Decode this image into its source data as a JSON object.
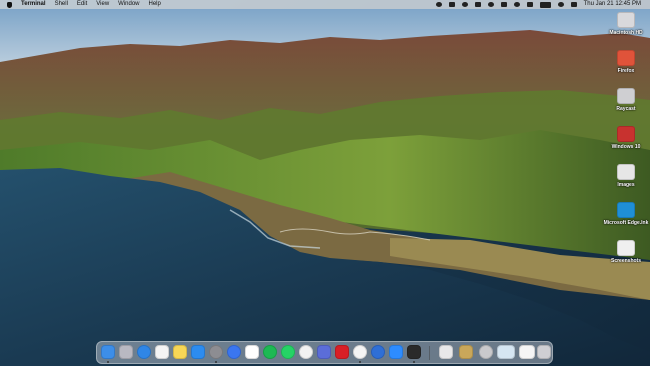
{
  "menubar": {
    "app_name": "Terminal",
    "menus": [
      "Shell",
      "Edit",
      "View",
      "Window",
      "Help"
    ],
    "clock": "Thu Jan 21  12:45 PM"
  },
  "desktop_icons": [
    {
      "label": "Macintosh HD",
      "icon": "hard-drive-icon",
      "color": "#d9d9dc"
    },
    {
      "label": "Firefox",
      "icon": "firefox-icon",
      "color": "#e0533a"
    },
    {
      "label": "Raycast",
      "icon": "raycast-icon",
      "color": "#cfcfd2"
    },
    {
      "label": "Windows 10",
      "icon": "windows-vm-icon",
      "color": "#c8322f"
    },
    {
      "label": "Images",
      "icon": "image-file-icon",
      "color": "#e6e6e6"
    },
    {
      "label": "Microsoft Edge.lnk",
      "icon": "edge-icon",
      "color": "#1f8fd6"
    },
    {
      "label": "Screenshots",
      "icon": "screenshot-file-icon",
      "color": "#efefef"
    }
  ],
  "dock": {
    "apps": [
      {
        "name": "Finder",
        "icon": "finder-icon",
        "color": "#3d8ee8",
        "running": true
      },
      {
        "name": "Launchpad",
        "icon": "launchpad-icon",
        "color": "#b9b9c2",
        "running": false
      },
      {
        "name": "Safari",
        "icon": "safari-icon",
        "color": "#2f86e6",
        "running": false
      },
      {
        "name": "Photos",
        "icon": "photos-icon",
        "color": "#f4f4f4",
        "running": false
      },
      {
        "name": "Notes",
        "icon": "notes-icon",
        "color": "#f6d656",
        "running": false
      },
      {
        "name": "App Store",
        "icon": "app-store-icon",
        "color": "#2c8cf0",
        "running": false
      },
      {
        "name": "System Preferences",
        "icon": "gear-icon",
        "color": "#8d8d92",
        "running": true
      },
      {
        "name": "Signal",
        "icon": "signal-icon",
        "color": "#3a76f0",
        "running": false
      },
      {
        "name": "Slack",
        "icon": "slack-icon",
        "color": "#ffffff",
        "running": false
      },
      {
        "name": "Spotify",
        "icon": "spotify-icon",
        "color": "#1db954",
        "running": false
      },
      {
        "name": "WhatsApp",
        "icon": "whatsapp-icon",
        "color": "#25d366",
        "running": false
      },
      {
        "name": "Todoist",
        "icon": "checkmark-icon",
        "color": "#f2f2f2",
        "running": false
      },
      {
        "name": "Screen Sharing",
        "icon": "screen-share-icon",
        "color": "#5b6dd8",
        "running": false
      },
      {
        "name": "Netflix",
        "icon": "netflix-icon",
        "color": "#d81f26",
        "running": false
      },
      {
        "name": "Chrome",
        "icon": "chrome-icon",
        "color": "#f4f4f4",
        "running": true
      },
      {
        "name": "Infuse",
        "icon": "play-icon",
        "color": "#2f6fd6",
        "running": false
      },
      {
        "name": "Zoom",
        "icon": "video-camera-icon",
        "color": "#2d8cff",
        "running": false
      },
      {
        "name": "Terminal",
        "icon": "terminal-icon",
        "color": "#2a2a2a",
        "running": true
      }
    ],
    "stack_items": [
      {
        "name": "Downloads Stack",
        "icon": "folder-stack-icon",
        "color": "#e8e8ea"
      },
      {
        "name": "Notes Stack",
        "icon": "document-stack-icon",
        "color": "#c9a75a"
      },
      {
        "name": "Help",
        "icon": "question-icon",
        "color": "#c9c9cc"
      },
      {
        "name": "Screenshot",
        "icon": "screenshot-thumb-icon",
        "color": "#d6e6f2"
      },
      {
        "name": "Document",
        "icon": "document-thumb-icon",
        "color": "#f5f5f5"
      },
      {
        "name": "Trash",
        "icon": "trash-icon",
        "color": "#cfcfd3"
      }
    ]
  }
}
